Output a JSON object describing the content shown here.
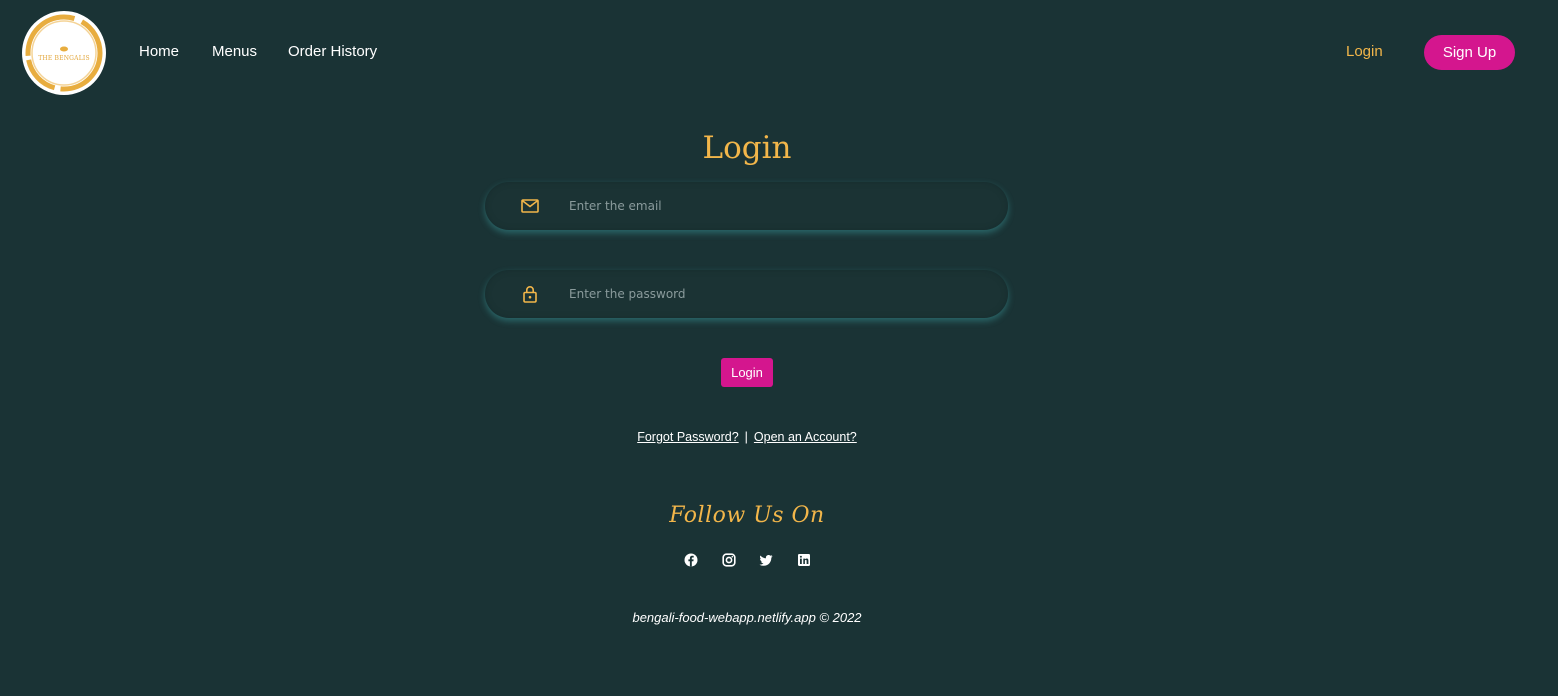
{
  "header": {
    "logo_text": "THE BENGALIS",
    "nav": {
      "home": "Home",
      "menus": "Menus",
      "order_history": "Order History"
    },
    "login_link": "Login",
    "signup_button": "Sign Up"
  },
  "login_form": {
    "title": "Login",
    "email": {
      "icon": "mail-icon",
      "placeholder": "Enter the email",
      "value": ""
    },
    "password": {
      "icon": "lock-icon",
      "placeholder": "Enter the password",
      "value": ""
    },
    "submit_label": "Login",
    "forgot_password": "Forgot Password?",
    "separator": "|",
    "open_account": "Open an Account?"
  },
  "footer": {
    "follow_title": "Follow Us On",
    "socials": [
      {
        "icon": "facebook-icon"
      },
      {
        "icon": "instagram-icon"
      },
      {
        "icon": "twitter-icon"
      },
      {
        "icon": "linkedin-icon"
      }
    ],
    "copyright": "bengali-food-webapp.netlify.app © 2022"
  },
  "colors": {
    "background": "#1a3335",
    "accent_gold": "#f2b64a",
    "accent_pink": "#d4168e",
    "text": "#ffffff"
  }
}
